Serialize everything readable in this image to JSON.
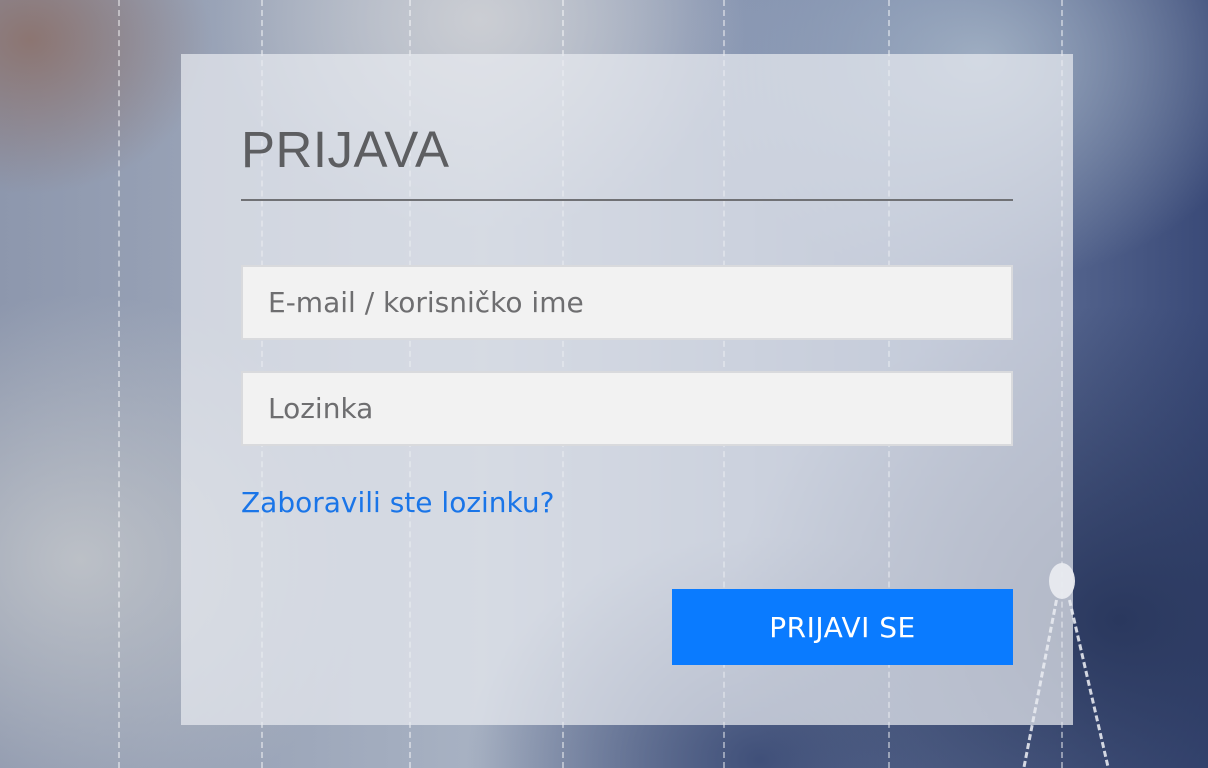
{
  "login": {
    "title": "PRIJAVA",
    "email_placeholder": "E-mail / korisničko ime",
    "password_placeholder": "Lozinka",
    "forgot_link": "Zaboravili ste lozinku?",
    "submit_label": "PRIJAVI SE"
  },
  "colors": {
    "accent": "#0a7bff",
    "link": "#1a75e8",
    "title": "#5d5e61",
    "field_background": "#f2f2f2"
  }
}
